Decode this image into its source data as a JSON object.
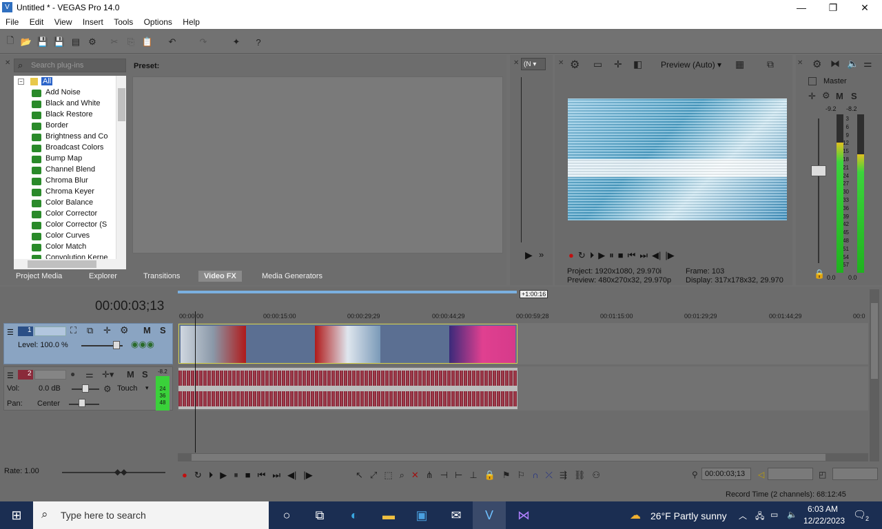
{
  "window": {
    "title": "Untitled * - VEGAS Pro 14.0"
  },
  "menu": [
    "File",
    "Edit",
    "View",
    "Insert",
    "Tools",
    "Options",
    "Help"
  ],
  "fx": {
    "search_placeholder": "Search plug-ins",
    "preset_label": "Preset:",
    "tree_root": "All",
    "items": [
      "Add Noise",
      "Black and White",
      "Black Restore",
      "Border",
      "Brightness and Co",
      "Broadcast Colors",
      "Bump Map",
      "Channel Blend",
      "Chroma Blur",
      "Chroma Keyer",
      "Color Balance",
      "Color Corrector",
      "Color Corrector (S",
      "Color Curves",
      "Color Match",
      "Convolution Kerne"
    ],
    "tabs": [
      "Project Media",
      "Explorer",
      "Transitions",
      "Video FX",
      "Media Generators"
    ],
    "active_tab": "Video FX"
  },
  "trimmer": {
    "dropdown": "(N"
  },
  "preview": {
    "mode": "Preview (Auto)",
    "project_label": "Project:",
    "project_value": "1920x1080, 29.970i",
    "preview_label": "Preview:",
    "preview_value": "480x270x32, 29.970p",
    "frame_label": "Frame:",
    "frame_value": "103",
    "display_label": "Display:",
    "display_value": "317x178x32, 29.970"
  },
  "master": {
    "label": "Master",
    "m": "M",
    "s": "S",
    "peak_l": "-9.2",
    "peak_r": "-8.2",
    "scale": [
      "3",
      "6",
      "9",
      "12",
      "15",
      "18",
      "21",
      "24",
      "27",
      "30",
      "33",
      "36",
      "39",
      "42",
      "45",
      "48",
      "51",
      "54",
      "57"
    ],
    "level_l": "0.0",
    "level_r": "0.0",
    "meter_l": 0.82,
    "meter_r": 0.75
  },
  "timeline": {
    "timecode": "00:00:03;13",
    "region_end": "+1:00:16",
    "ruler": [
      "00:00:00",
      "00:00:15:00",
      "00:00:29;29",
      "00:00:44;29",
      "00:00:59;28",
      "00:01:15:00",
      "00:01:29;29",
      "00:01:44;29",
      "00:0"
    ],
    "video_track": {
      "num": "1",
      "m": "M",
      "s": "S",
      "level": "Level: 100.0 %"
    },
    "audio_track": {
      "num": "2",
      "m": "M",
      "s": "S",
      "vol_label": "Vol:",
      "vol_value": "0.0 dB",
      "pan_label": "Pan:",
      "pan_value": "Center",
      "automation": "Touch",
      "peak": "-8.2",
      "meter_vals": [
        "24",
        "36",
        "48"
      ]
    },
    "rate": "Rate: 1.00",
    "cursor_time": "00:00:03;13"
  },
  "status": {
    "record_time": "Record Time (2 channels): 68:12:45"
  },
  "taskbar": {
    "search_placeholder": "Type here to search",
    "weather": "26°F  Partly sunny",
    "time": "6:03 AM",
    "date": "12/22/2023",
    "notifications": "2"
  }
}
